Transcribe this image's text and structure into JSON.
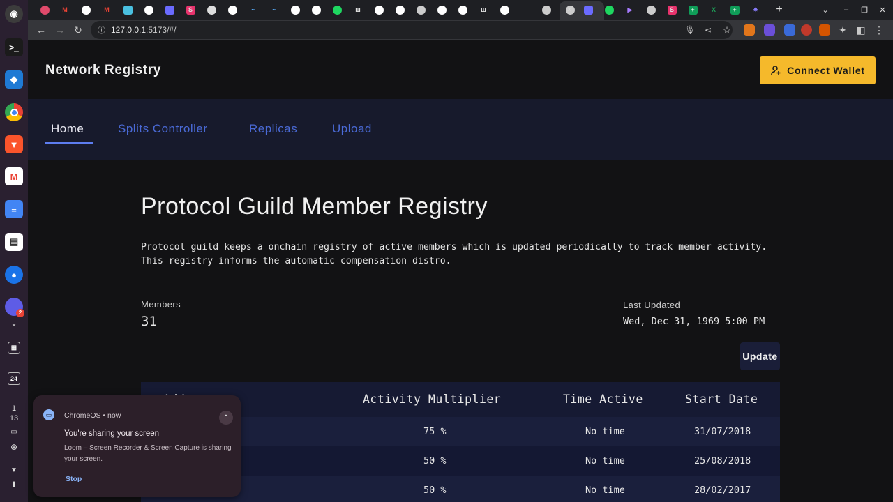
{
  "browser": {
    "url_host": "127.0.0.1",
    "url_rest": ":5173/#/",
    "active_tab_close": "×",
    "new_tab": "+"
  },
  "shelf": {
    "badge_count": "2",
    "calendar_day": "24",
    "clock_hour": "1",
    "clock_minute": "13"
  },
  "header": {
    "brand": "Network Registry",
    "connect_label": "Connect Wallet"
  },
  "nav": {
    "tabs": [
      {
        "label": "Home",
        "active": true
      },
      {
        "label": "Splits Controller",
        "active": false
      },
      {
        "label": "Replicas",
        "active": false
      },
      {
        "label": "Upload",
        "active": false
      }
    ]
  },
  "main": {
    "title": "Protocol Guild Member Registry",
    "description": "Protocol guild keeps a onchain registry of active members which is updated periodically to track member activity. This registry informs the automatic compensation distro.",
    "members_label": "Members",
    "members_value": "31",
    "last_updated_label": "Last Updated",
    "last_updated_value": "Wed, Dec 31, 1969 5:00 PM",
    "update_label": "Update"
  },
  "table": {
    "headers": [
      "Address",
      "Activity Multiplier",
      "Time Active",
      "Start Date"
    ],
    "rows": [
      {
        "multiplier": "75 %",
        "time_active": "No time",
        "start_date": "31/07/2018"
      },
      {
        "multiplier": "50 %",
        "time_active": "No time",
        "start_date": "25/08/2018"
      },
      {
        "multiplier": "50 %",
        "time_active": "No time",
        "start_date": "28/02/2017"
      }
    ]
  },
  "notification": {
    "app": "ChromeOS",
    "time": "now",
    "title": "You're sharing your screen",
    "body": "Loom – Screen Recorder & Screen Capture is sharing your screen.",
    "action": "Stop"
  },
  "colors": {
    "accent": "#f5b92b",
    "nav_bg": "#171a2c",
    "nav_link": "#4a6ad6",
    "table_header": "#161a33"
  }
}
